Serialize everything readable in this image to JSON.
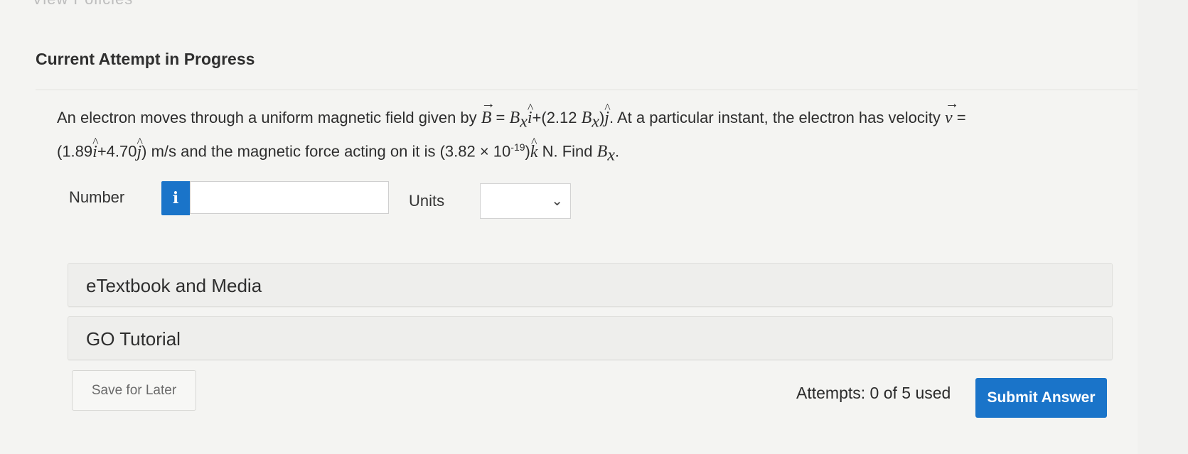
{
  "header": {
    "cut_title": "View Policies",
    "title": "Current Attempt in Progress"
  },
  "question": {
    "p1": "An electron moves through a uniform magnetic field given by ",
    "B": "B",
    "eq": " = ",
    "Bx": "B",
    "x_sub": "x",
    "i_hat": "i",
    "plus1": "+(2.12 ",
    "Bx2": "B",
    "x_sub2": "x",
    "close1": ")",
    "j_hat": "j",
    "p2": ". At a particular instant, the electron has velocity ",
    "v": "v",
    "eq2": " =",
    "p3": "(1.89",
    "i_hat2": "i",
    "p4": "+4.70",
    "j_hat2": "j",
    "p5": ") m/s and the magnetic force acting on it is (3.82 × 10",
    "exp": "-19",
    "p6": ")",
    "k_hat": "k",
    "p7": " N. Find ",
    "Bx3": "B",
    "x_sub3": "x",
    "p8": "."
  },
  "answer": {
    "number_label": "Number",
    "info_icon": "i",
    "number_value": "",
    "units_label": "Units",
    "units_selected": ""
  },
  "sections": {
    "etextbook": "eTextbook and Media",
    "go_tutorial": "GO Tutorial"
  },
  "footer": {
    "save_label": "Save for Later",
    "attempts": "Attempts: 0 of 5 used",
    "submit_label": "Submit Answer"
  },
  "colors": {
    "accent": "#1a74c9",
    "background": "#f4f4f2"
  }
}
